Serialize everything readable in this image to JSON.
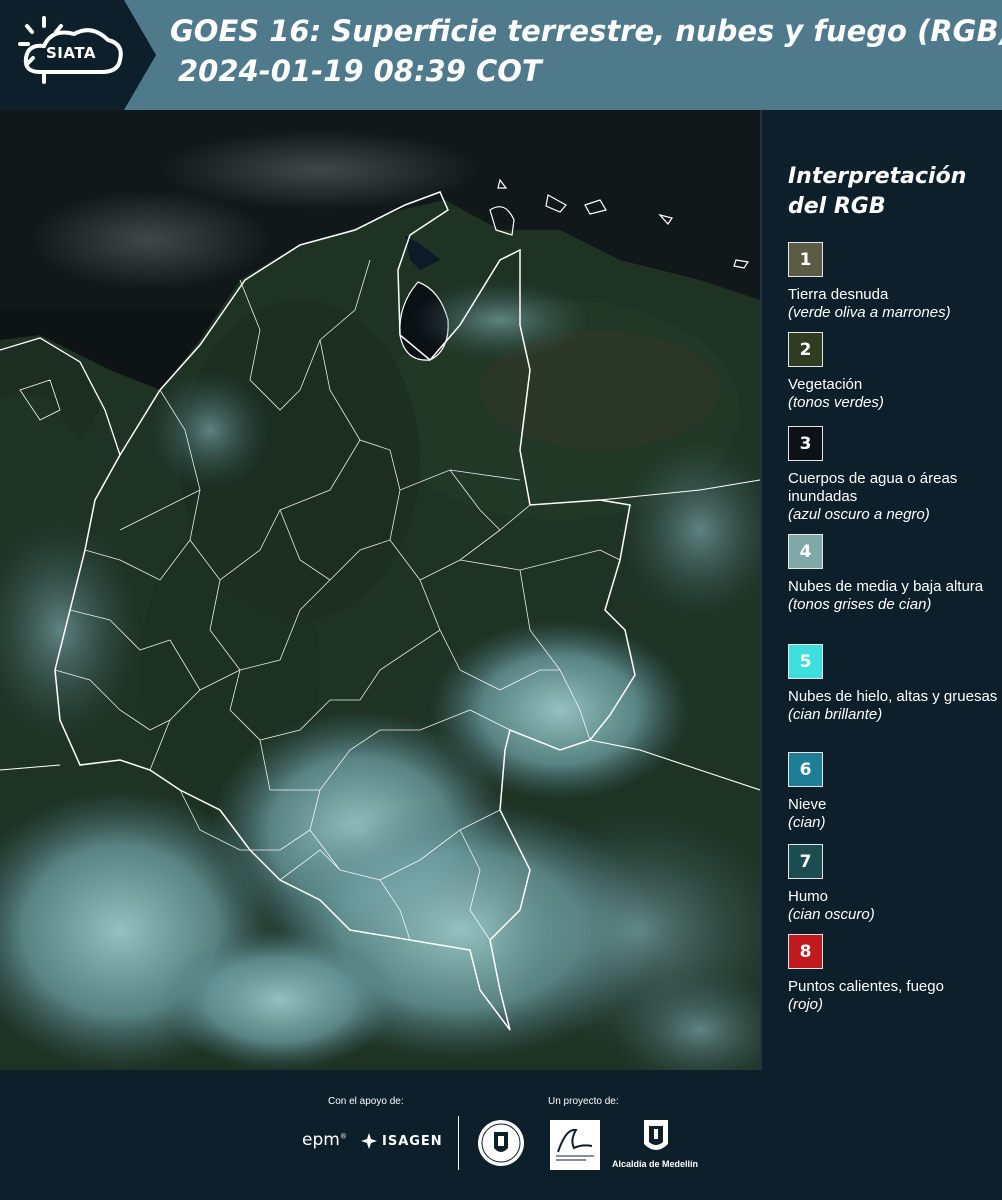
{
  "header": {
    "logo_text": "SIATA",
    "title_line1": "GOES 16: Superficie terrestre, nubes y fuego (RGB)",
    "title_line2": "2024-01-19 08:39 COT",
    "colors": {
      "background": "#4f7a8c",
      "logo_panel": "#0c1f2b"
    }
  },
  "map": {
    "description_icon": "satellite-rgb-map",
    "colors": {
      "ocean": "#0e1416",
      "land": "#1f3427",
      "cloud": "#7fb0b3",
      "borders": "#ffffff"
    }
  },
  "legend": {
    "title": "Interpretación del RGB",
    "items": [
      {
        "number": "1",
        "color": "#5c5c45",
        "label": "Tierra desnuda",
        "sub": "(verde oliva a marrones)"
      },
      {
        "number": "2",
        "color": "#2e3d21",
        "label": "Vegetación",
        "sub": "(tonos verdes)"
      },
      {
        "number": "3",
        "color": "#0c1218",
        "label": "Cuerpos de agua o áreas inundadas",
        "sub": "(azul oscuro a negro)"
      },
      {
        "number": "4",
        "color": "#7fa8a8",
        "label": "Nubes de media y baja altura",
        "sub": "(tonos grises de cian)"
      },
      {
        "number": "5",
        "color": "#3fdede",
        "label": "Nubes de hielo, altas y gruesas",
        "sub": "(cian brillante)"
      },
      {
        "number": "6",
        "color": "#1d7e95",
        "label": "Nieve",
        "sub": "(cian)"
      },
      {
        "number": "7",
        "color": "#1d4c50",
        "label": "Humo",
        "sub": "(cian oscuro)"
      },
      {
        "number": "8",
        "color": "#c01a1f",
        "label": "Puntos calientes, fuego",
        "sub": "(rojo)"
      }
    ]
  },
  "footer": {
    "support_label": "Con el apoyo de:",
    "project_label": "Un proyecto de:",
    "epm": "epm",
    "epm_mark": "®",
    "isagen": "ISAGEN",
    "alcaldia": "Alcaldía de Medellín"
  }
}
